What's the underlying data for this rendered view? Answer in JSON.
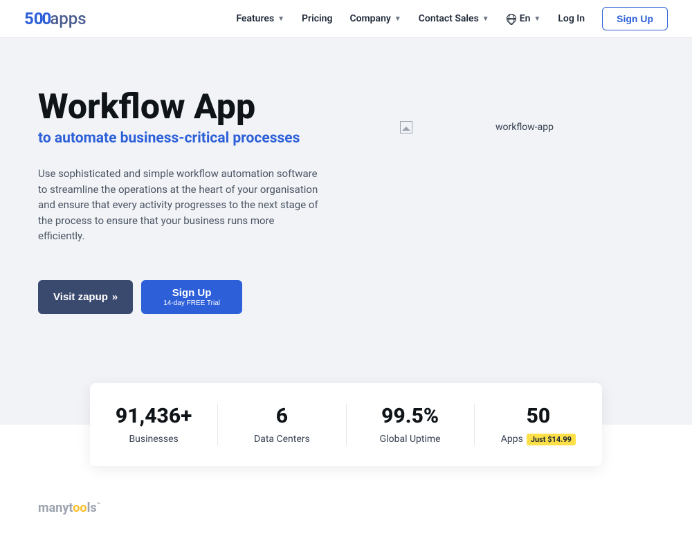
{
  "header": {
    "logo": {
      "five": "5",
      "zeros": "00",
      "apps": "apps"
    },
    "nav": {
      "features": "Features",
      "pricing": "Pricing",
      "company": "Company",
      "contact": "Contact Sales",
      "lang": "En",
      "login": "Log In",
      "signup": "Sign Up"
    }
  },
  "hero": {
    "title": "Workflow App",
    "subtitle": "to automate business-critical processes",
    "description": "Use sophisticated and simple workflow automation software to streamline the operations at the heart of your organisation and ensure that every activity progresses to the next stage of the process to ensure that your business runs more efficiently.",
    "btn_visit": "Visit zapup",
    "btn_signup_main": "Sign Up",
    "btn_signup_sub": "14-day FREE Trial",
    "image_alt": "workflow-app"
  },
  "stats": [
    {
      "value": "91,436+",
      "label": "Businesses"
    },
    {
      "value": "6",
      "label": "Data Centers"
    },
    {
      "value": "99.5%",
      "label": "Global Uptime"
    },
    {
      "value": "50",
      "label": "Apps",
      "badge": "Just $14.99"
    }
  ],
  "footer": {
    "logo_many": "manyt",
    "logo_oo": "oo",
    "logo_ls": "ls",
    "logo_tm": "™"
  }
}
